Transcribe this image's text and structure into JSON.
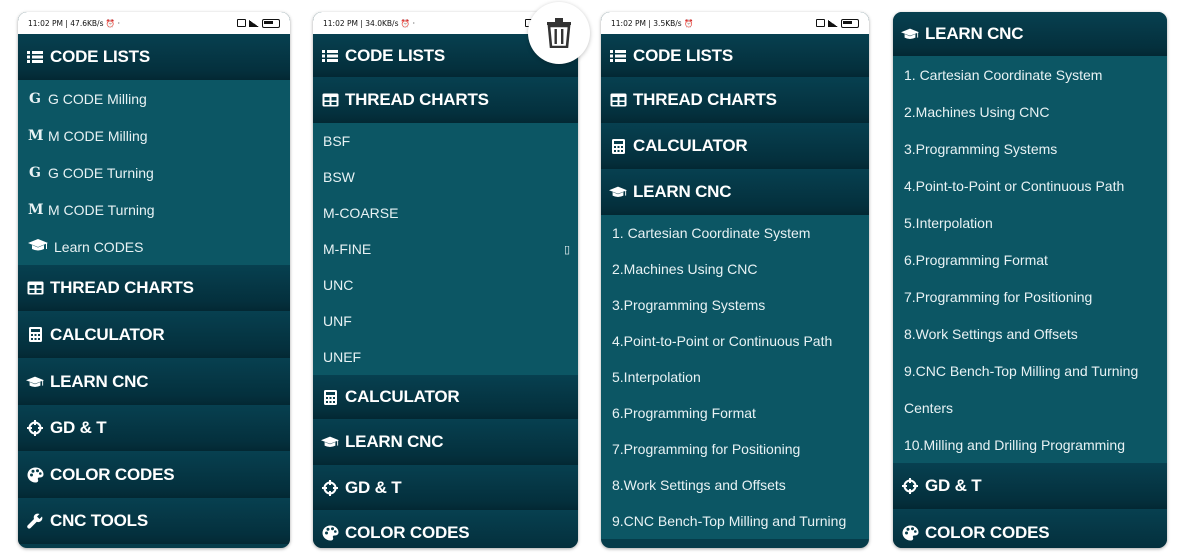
{
  "screens": [
    {
      "status": {
        "left": "11:02 PM | 47.6KB/s ⏰ ·"
      },
      "rows": [
        {
          "k": "section",
          "label": "CODE LISTS",
          "icon": "list-icon",
          "h": 46
        },
        {
          "k": "item",
          "label": "G CODE Milling",
          "lead": "G",
          "h": 37
        },
        {
          "k": "item",
          "label": "M CODE Milling",
          "lead": "M",
          "h": 37
        },
        {
          "k": "item",
          "label": "G CODE Turning",
          "lead": "G",
          "h": 37
        },
        {
          "k": "item",
          "label": "M CODE Turning",
          "lead": "M",
          "h": 37
        },
        {
          "k": "item",
          "label": "Learn CODES",
          "icon": "graduation-cap-icon",
          "h": 37
        },
        {
          "k": "section",
          "label": "THREAD CHARTS",
          "icon": "table-icon",
          "h": 46
        },
        {
          "k": "section",
          "label": "CALCULATOR",
          "icon": "calculator-icon",
          "h": 47
        },
        {
          "k": "section",
          "label": "LEARN CNC",
          "icon": "graduation-cap-icon",
          "h": 47
        },
        {
          "k": "section",
          "label": "GD & T",
          "icon": "crosshair-icon",
          "h": 46
        },
        {
          "k": "section",
          "label": "COLOR CODES",
          "icon": "palette-icon",
          "h": 47
        },
        {
          "k": "section",
          "label": "CNC TOOLS",
          "icon": "wrench-icon",
          "h": 46
        }
      ]
    },
    {
      "status": {
        "left": "11:02 PM | 34.0KB/s ⏰ ·"
      },
      "rows": [
        {
          "k": "section",
          "label": "CODE LISTS",
          "icon": "list-icon",
          "h": 43
        },
        {
          "k": "section",
          "label": "THREAD CHARTS",
          "icon": "table-icon",
          "h": 46
        },
        {
          "k": "item",
          "label": "BSF",
          "h": 36
        },
        {
          "k": "item",
          "label": "BSW",
          "h": 36
        },
        {
          "k": "item",
          "label": "M-COARSE",
          "h": 36
        },
        {
          "k": "item",
          "label": "M-FINE",
          "h": 36,
          "trail": "▯"
        },
        {
          "k": "item",
          "label": "UNC",
          "h": 36
        },
        {
          "k": "item",
          "label": "UNF",
          "h": 36
        },
        {
          "k": "item",
          "label": "UNEF",
          "h": 36
        },
        {
          "k": "section",
          "label": "CALCULATOR",
          "icon": "calculator-icon",
          "h": 44
        },
        {
          "k": "section",
          "label": "LEARN CNC",
          "icon": "graduation-cap-icon",
          "h": 46
        },
        {
          "k": "section",
          "label": "GD & T",
          "icon": "crosshair-icon",
          "h": 45
        },
        {
          "k": "section",
          "label": "COLOR CODES",
          "icon": "palette-icon",
          "h": 46
        }
      ]
    },
    {
      "status": {
        "left": "11:02 PM | 3.5KB/s ⏰"
      },
      "rows": [
        {
          "k": "section",
          "label": "CODE LISTS",
          "icon": "list-icon",
          "h": 43
        },
        {
          "k": "section",
          "label": "THREAD CHARTS",
          "icon": "table-icon",
          "h": 46
        },
        {
          "k": "section",
          "label": "CALCULATOR",
          "icon": "calculator-icon",
          "h": 46
        },
        {
          "k": "section",
          "label": "LEARN CNC",
          "icon": "graduation-cap-icon",
          "h": 46
        },
        {
          "k": "item",
          "label": "1. Cartesian Coordinate System",
          "h": 36
        },
        {
          "k": "item",
          "label": "2.Machines Using CNC",
          "h": 36
        },
        {
          "k": "item",
          "label": "3.Programming Systems",
          "h": 36
        },
        {
          "k": "item",
          "label": "4.Point-to-Point or Continuous Path",
          "h": 36
        },
        {
          "k": "item",
          "label": "5.Interpolation",
          "h": 36
        },
        {
          "k": "item",
          "label": "6.Programming Format",
          "h": 36
        },
        {
          "k": "item",
          "label": "7.Programming for Positioning",
          "h": 36
        },
        {
          "k": "item",
          "label": "8.Work Settings and Offsets",
          "h": 36
        },
        {
          "k": "item",
          "label": "9.CNC Bench-Top Milling and Turning",
          "h": 36
        }
      ]
    },
    {
      "rows": [
        {
          "k": "section",
          "label": "LEARN CNC",
          "icon": "graduation-cap-icon",
          "h": 44
        },
        {
          "k": "item",
          "label": "1. Cartesian Coordinate System",
          "h": 37
        },
        {
          "k": "item",
          "label": "2.Machines Using CNC",
          "h": 37
        },
        {
          "k": "item",
          "label": "3.Programming Systems",
          "h": 37
        },
        {
          "k": "item",
          "label": "4.Point-to-Point or Continuous Path",
          "h": 37
        },
        {
          "k": "item",
          "label": "5.Interpolation",
          "h": 37
        },
        {
          "k": "item",
          "label": "6.Programming Format",
          "h": 37
        },
        {
          "k": "item",
          "label": "7.Programming for Positioning",
          "h": 37
        },
        {
          "k": "item",
          "label": "8.Work Settings and Offsets",
          "h": 37
        },
        {
          "k": "item",
          "label": "9.CNC Bench-Top Milling and Turning",
          "h": 37
        },
        {
          "k": "item",
          "label": "Centers",
          "h": 37
        },
        {
          "k": "item",
          "label": "10.Milling and Drilling Programming",
          "h": 37
        },
        {
          "k": "section",
          "label": "GD & T",
          "icon": "crosshair-icon",
          "h": 46
        },
        {
          "k": "section",
          "label": "COLOR CODES",
          "icon": "palette-icon",
          "h": 48
        }
      ]
    }
  ],
  "trash": {
    "icon": "trash-icon"
  }
}
